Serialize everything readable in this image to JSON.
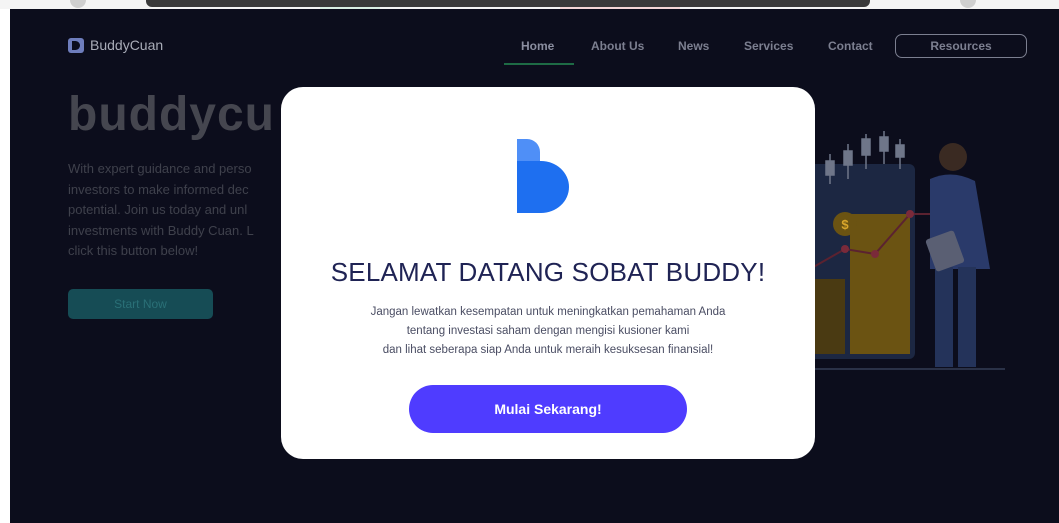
{
  "browser": {
    "name": "browser-top-strip"
  },
  "nav": {
    "brand": "BuddyCuan",
    "links": [
      "Home",
      "About Us",
      "News",
      "Services",
      "Contact"
    ],
    "resources": "Resources"
  },
  "hero": {
    "title": "buddycu",
    "body_lines": [
      "With expert guidance and perso",
      "investors to make informed dec",
      "potential. Join us today and unl",
      "investments with Buddy Cuan. L",
      "click this button below!"
    ],
    "cta": "Start Now"
  },
  "illustration": {
    "coin_symbol": "$"
  },
  "modal": {
    "title": "SELAMAT DATANG SOBAT BUDDY!",
    "description_lines": [
      "Jangan lewatkan kesempatan untuk meningkatkan pemahaman Anda",
      "tentang investasi saham dengan mengisi kusioner kami",
      "dan lihat seberapa siap Anda untuk meraih kesuksesan finansial!"
    ],
    "button": "Mulai Sekarang!"
  },
  "colors": {
    "page_bg": "#0c0d1c",
    "modal_bg": "#ffffff",
    "title": "#1f2354",
    "cta": "#4f3cff",
    "logo_blue": "#1e6ff0",
    "logo_light": "#4f8ff7"
  }
}
